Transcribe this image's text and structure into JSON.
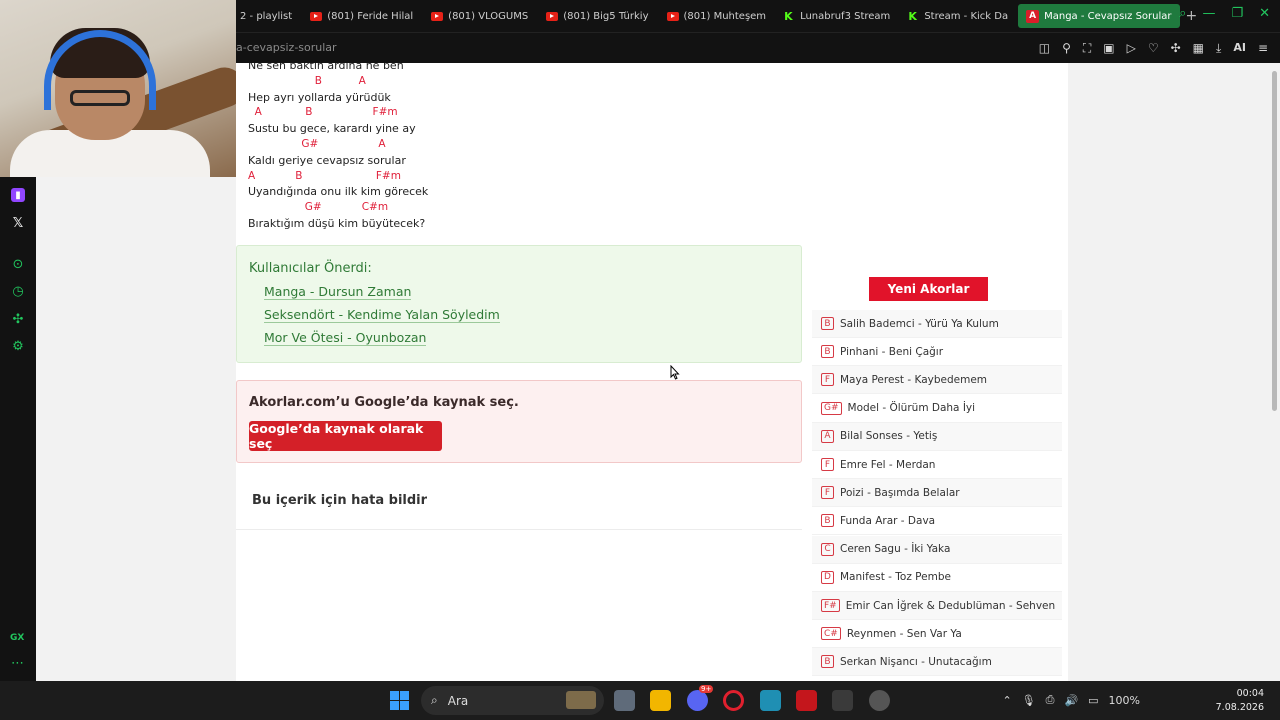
{
  "browser": {
    "tabs": [
      {
        "label": "2 - playlist",
        "kind": "plain"
      },
      {
        "label": "(801) Feride Hilal",
        "kind": "youtube"
      },
      {
        "label": "(801) VLOGUMS",
        "kind": "youtube"
      },
      {
        "label": "(801) Big5 Türkiy",
        "kind": "youtube"
      },
      {
        "label": "(801) Muhteşem",
        "kind": "youtube"
      },
      {
        "label": "Lunabruf3 Stream",
        "kind": "kick"
      },
      {
        "label": "Stream - Kick Da",
        "kind": "kick"
      },
      {
        "label": "Manga - Cevapsız Sorular",
        "kind": "akorlar",
        "active": true
      }
    ],
    "new_tab": "+",
    "url": "a-cevapsiz-sorular",
    "ai_label": "AI",
    "accent": "#22c55e"
  },
  "lyrics": [
    {
      "type": "text",
      "text": "Ne sen baktın ardına ne ben"
    },
    {
      "type": "chord",
      "text": "                    B           A"
    },
    {
      "type": "text",
      "text": "Hep ayrı yollarda yürüdük"
    },
    {
      "type": "chord",
      "text": "  A             B                  F#m"
    },
    {
      "type": "text",
      "text": "Sustu bu gece, karardı yine ay"
    },
    {
      "type": "chord",
      "text": "                G#                  A"
    },
    {
      "type": "text",
      "text": "Kaldı geriye cevapsız sorular"
    },
    {
      "type": "chord",
      "text": "A            B                      F#m"
    },
    {
      "type": "text",
      "text": "Uyandığında onu ilk kim görecek"
    },
    {
      "type": "chord",
      "text": "                 G#            C#m"
    },
    {
      "type": "text",
      "text": "Bıraktığım düşü kim büyütecek?"
    }
  ],
  "suggestions": {
    "title": "Kullanıcılar Önerdi:",
    "items": [
      "Manga - Dursun Zaman",
      "Seksendört - Kendime Yalan Söyledim",
      "Mor Ve Ötesi - Oyunbozan"
    ]
  },
  "google": {
    "title": "Akorlar.com’u Google’da kaynak seç.",
    "button": "Google’da kaynak olarak seç"
  },
  "report": "Bu içerik için hata bildir",
  "new_chords": {
    "button": "Yeni Akorlar",
    "items": [
      {
        "key": "B",
        "song": "Salih Bademci - Yürü Ya Kulum"
      },
      {
        "key": "B",
        "song": "Pinhani - Beni Çağır"
      },
      {
        "key": "F",
        "song": "Maya Perest - Kaybedemem"
      },
      {
        "key": "G#",
        "song": "Model - Ölürüm Daha İyi"
      },
      {
        "key": "A",
        "song": "Bilal Sonses - Yetiş"
      },
      {
        "key": "F",
        "song": "Emre Fel - Merdan"
      },
      {
        "key": "F",
        "song": "Poizi - Başımda Belalar"
      },
      {
        "key": "B",
        "song": "Funda Arar - Dava"
      },
      {
        "key": "C",
        "song": "Ceren Sagu - İki Yaka"
      },
      {
        "key": "D",
        "song": "Manifest - Toz Pembe"
      },
      {
        "key": "F#",
        "song": "Emir Can İğrek & Dedublüman - Sehven"
      },
      {
        "key": "C#",
        "song": "Reynmen - Sen Var Ya"
      },
      {
        "key": "B",
        "song": "Serkan Nişancı - Unutacağım"
      }
    ]
  },
  "taskbar": {
    "search_placeholder": "Ara",
    "battery": "100%",
    "time": "00:04",
    "date": "7.08.2026",
    "discord_badge": "9+"
  }
}
